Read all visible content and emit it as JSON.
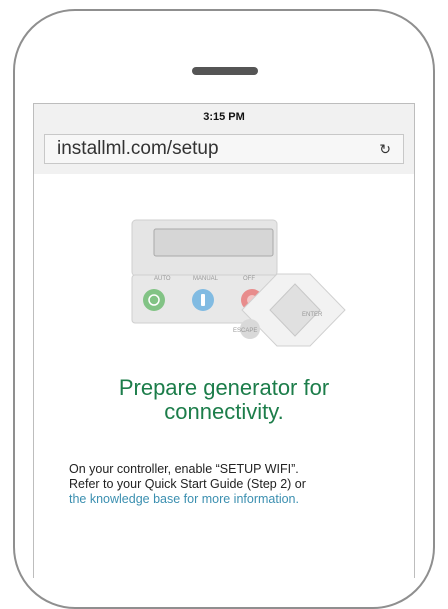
{
  "status": {
    "time": "3:15 PM"
  },
  "browser": {
    "url": "installml.com/setup",
    "reload_icon": "reload-icon"
  },
  "controller": {
    "labels": {
      "auto": "AUTO",
      "manual": "MANUAL",
      "off": "OFF",
      "enter": "ENTER",
      "escape": "ESCAPE"
    },
    "colors": {
      "auto": "#4caf50",
      "manual": "#4aa3df",
      "off": "#e85a5a"
    }
  },
  "content": {
    "headline_line1": "Prepare generator for",
    "headline_line2": "connectivity.",
    "instruction_line1": "On your controller, enable “SETUP WIFI”.",
    "instruction_line2": "Refer to your Quick Start Guide (Step 2) or",
    "link_text": "the knowledge base for more information."
  }
}
